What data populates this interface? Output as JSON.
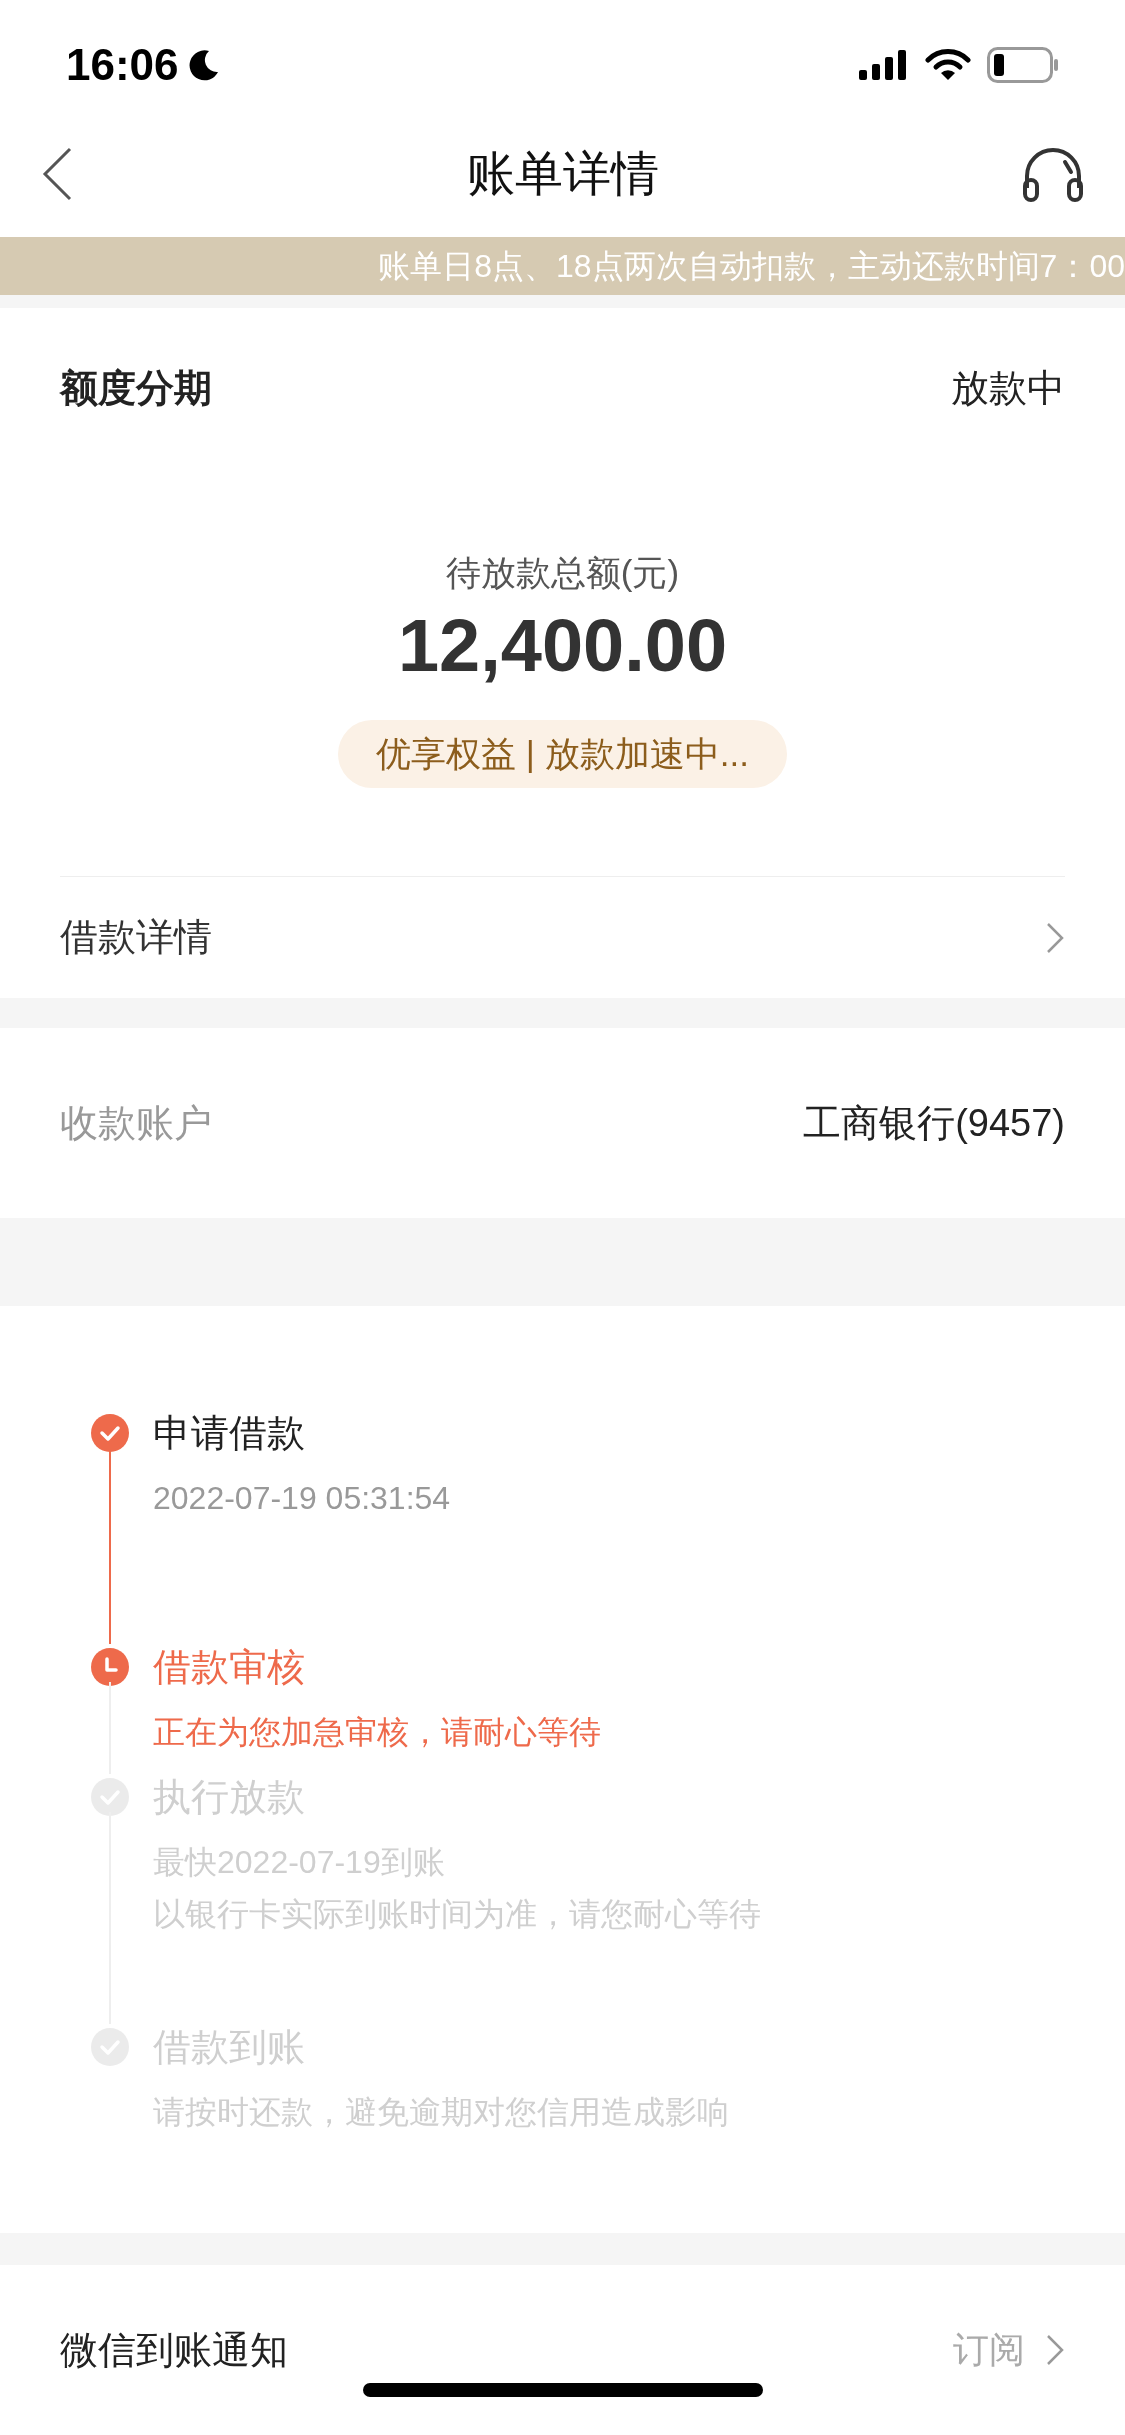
{
  "status_bar": {
    "time": "16:06"
  },
  "nav": {
    "title": "账单详情"
  },
  "notice": "账单日8点、18点两次自动扣款，主动还款时间7：00",
  "summary": {
    "type_label": "额度分期",
    "status": "放款中",
    "amount_label": "待放款总额(元)",
    "amount": "12,400.00",
    "badge": "优享权益 | 放款加速中...",
    "detail_link": "借款详情"
  },
  "account": {
    "label": "收款账户",
    "value": "工商银行(9457)"
  },
  "steps": [
    {
      "title": "申请借款",
      "kind": "done",
      "lines": [
        "2022-07-19 05:31:54"
      ]
    },
    {
      "title": "借款审核",
      "kind": "active",
      "lines": [
        "正在为您加急审核，请耐心等待"
      ]
    },
    {
      "title": "执行放款",
      "kind": "pending",
      "lines": [
        "最快2022-07-19到账",
        "以银行卡实际到账时间为准，请您耐心等待"
      ]
    },
    {
      "title": "借款到账",
      "kind": "pending",
      "lines": [
        "请按时还款，避免逾期对您信用造成影响"
      ]
    }
  ],
  "notify": {
    "label": "微信到账通知",
    "action": "订阅"
  }
}
